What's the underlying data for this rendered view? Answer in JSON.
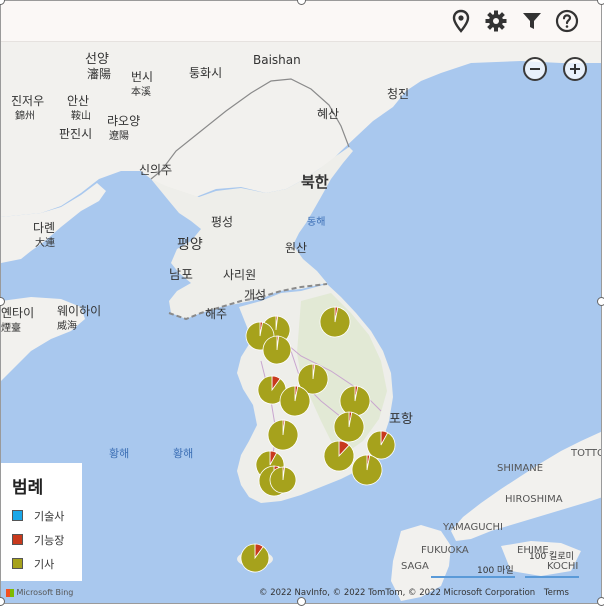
{
  "toolbar": {
    "icons": [
      "location-pin-icon",
      "gear-icon",
      "filter-icon",
      "help-icon"
    ]
  },
  "map": {
    "zoom_in": "+",
    "zoom_out": "−",
    "labels": {
      "shenyang": "선양",
      "shenyang_cn": "瀋陽",
      "benxi": "번시",
      "benxi_cn": "本溪",
      "tonghua": "퉁화시",
      "baishan": "Baishan",
      "jinzhou": "진저우",
      "jinzhou_cn": "錦州",
      "anshan": "안산",
      "anshan_cn": "鞍山",
      "liaoyang": "랴오양",
      "liaoyang_cn": "遼陽",
      "panjin": "판진시",
      "hyesan": "혜산",
      "chongjin": "청진",
      "sinuiju": "신의주",
      "north_korea": "북한",
      "east_sea": "동해",
      "pyongsong": "평성",
      "pyongyang": "평양",
      "wonsan": "원산",
      "dalian": "다롄",
      "dalian_cn": "大連",
      "nampo": "남포",
      "sariwon": "사리원",
      "kaesong": "개성",
      "haeju": "해주",
      "yantai": "옌타이",
      "yantai_cn": "煙臺",
      "weihai": "웨이하이",
      "weihai_cn": "威海",
      "pohang": "포항",
      "yellow_sea_1": "황해",
      "yellow_sea_2": "황해",
      "shimane": "SHIMANE",
      "tottori": "TOTTO",
      "hiroshima": "HIROSHIMA",
      "yamaguchi": "YAMAGUCHI",
      "fukuoka": "FUKUOKA",
      "ehime": "EHIME",
      "saga": "SAGA",
      "kochi": "KOCHI"
    },
    "scale_mile": "100 마일",
    "scale_km": "100 킬로미",
    "copyright": "© 2022 NavInfo, © 2022 TomTom, © 2022 Microsoft Corporation",
    "terms": "Terms",
    "bing": "Microsoft Bing"
  },
  "legend": {
    "title": "범례",
    "items": [
      {
        "label": "기술사",
        "color": "#1aa7e8"
      },
      {
        "label": "기능장",
        "color": "#c8391c"
      },
      {
        "label": "기사",
        "color": "#a6a21c"
      }
    ]
  },
  "colors": {
    "sea": "#a9c8ee",
    "land": "#f2f1ee",
    "land_korea": "#eeeeea",
    "forest": "#d9e6c6",
    "border": "#888888",
    "dmz": "#8a8a8a",
    "pie_main": "#a6a21c",
    "pie_red": "#c8391c"
  },
  "chart_data": {
    "type": "pie",
    "note_series": [
      "기술사",
      "기능장",
      "기사"
    ],
    "pies": [
      {
        "id": "p1",
        "values": [
          0,
          2,
          98
        ]
      },
      {
        "id": "p2",
        "values": [
          0,
          3,
          97
        ]
      },
      {
        "id": "p3",
        "values": [
          0,
          2,
          98
        ]
      },
      {
        "id": "p4",
        "values": [
          0,
          3,
          97
        ]
      },
      {
        "id": "p5",
        "values": [
          0,
          2,
          98
        ]
      },
      {
        "id": "p6",
        "values": [
          0,
          10,
          90
        ]
      },
      {
        "id": "p7",
        "values": [
          0,
          3,
          97
        ]
      },
      {
        "id": "p8",
        "values": [
          0,
          3,
          97
        ]
      },
      {
        "id": "p9",
        "values": [
          0,
          8,
          92
        ]
      },
      {
        "id": "p10",
        "values": [
          0,
          3,
          97
        ]
      },
      {
        "id": "p11",
        "values": [
          0,
          2,
          98
        ]
      },
      {
        "id": "p12",
        "values": [
          0,
          12,
          88
        ]
      },
      {
        "id": "p13",
        "values": [
          0,
          3,
          97
        ]
      },
      {
        "id": "p14",
        "values": [
          0,
          8,
          92
        ]
      },
      {
        "id": "p15",
        "values": [
          0,
          5,
          95
        ]
      },
      {
        "id": "p16",
        "values": [
          0,
          10,
          90
        ]
      },
      {
        "id": "p17",
        "values": [
          0,
          2,
          98
        ]
      }
    ]
  }
}
